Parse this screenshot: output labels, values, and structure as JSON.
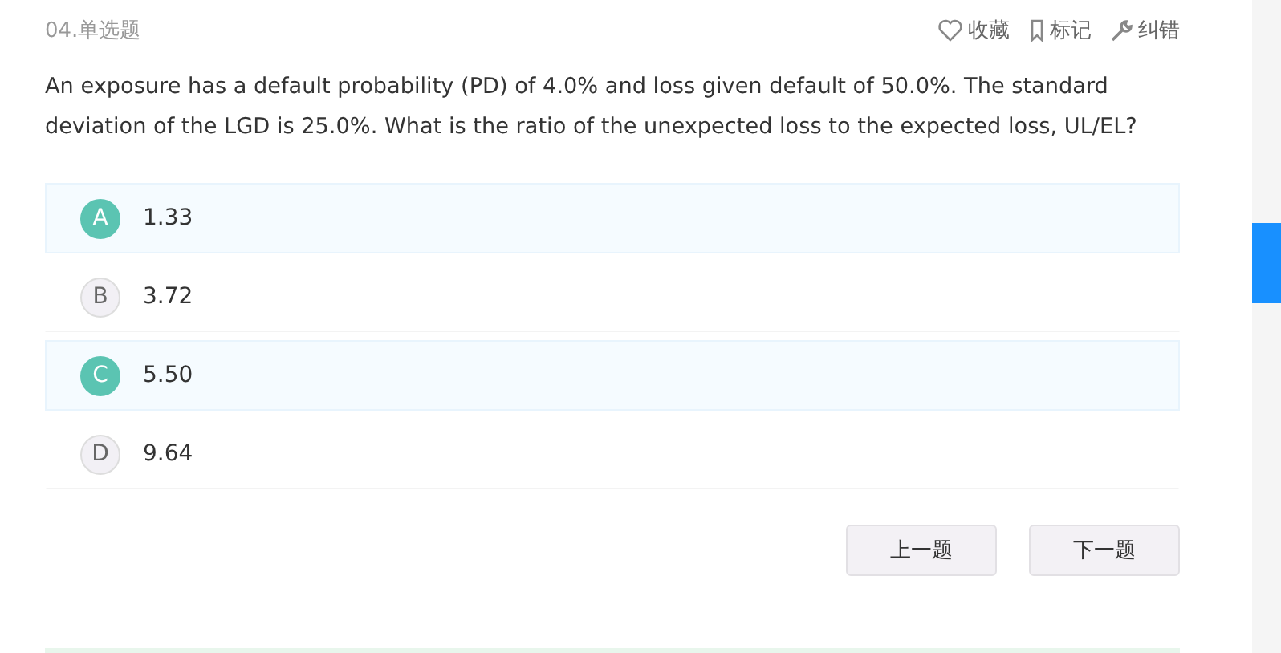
{
  "question": {
    "number": "04.单选题",
    "text": "An exposure has a default probability (PD) of 4.0% and loss given default of 50.0%. The standard deviation of the LGD is 25.0%. What is the ratio of the unexpected loss to the expected loss, UL/EL?"
  },
  "actions": [
    {
      "kind": "favorite",
      "label": "收藏"
    },
    {
      "kind": "bookmark",
      "label": "标记"
    },
    {
      "kind": "wrench",
      "label": "纠错"
    }
  ],
  "options": [
    {
      "letter": "A",
      "text": "1.33",
      "selected": true
    },
    {
      "letter": "B",
      "text": "3.72",
      "selected": false
    },
    {
      "letter": "C",
      "text": "5.50",
      "selected": true
    },
    {
      "letter": "D",
      "text": "9.64",
      "selected": false
    }
  ],
  "buttons": [
    "上一题",
    "下一题"
  ]
}
